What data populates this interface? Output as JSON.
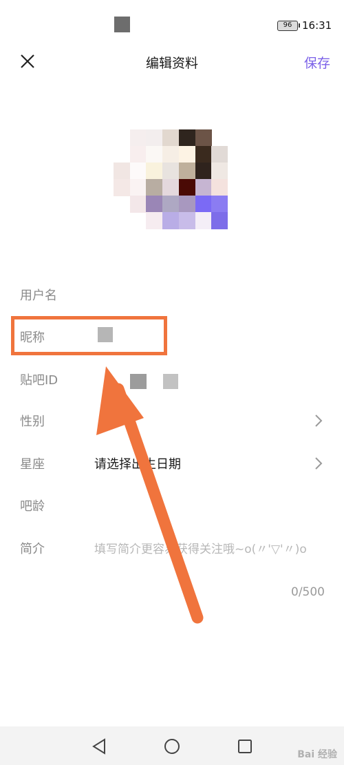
{
  "status_bar": {
    "battery": "96",
    "time": "16:31"
  },
  "header": {
    "title": "编辑资料",
    "save_label": "保存"
  },
  "fields": {
    "username": {
      "label": "用户名"
    },
    "nickname": {
      "label": "昵称"
    },
    "tieba_id": {
      "label": "贴吧ID"
    },
    "gender": {
      "label": "性别"
    },
    "constellation": {
      "label": "星座",
      "value": "请选择出生日期"
    },
    "tieba_age": {
      "label": "吧龄"
    },
    "bio": {
      "label": "简介",
      "placeholder": "填写简介更容易获得关注哦~o(〃'▽'〃)o",
      "counter": "0/500"
    }
  },
  "annotation": {
    "color": "#f0743d"
  },
  "accent_color": "#7b61e8",
  "watermark": {
    "text": "Bai 经验"
  },
  "icons": [
    "close-icon",
    "chevron-right-icon",
    "back-triangle-icon",
    "home-circle-icon",
    "recents-square-icon"
  ]
}
